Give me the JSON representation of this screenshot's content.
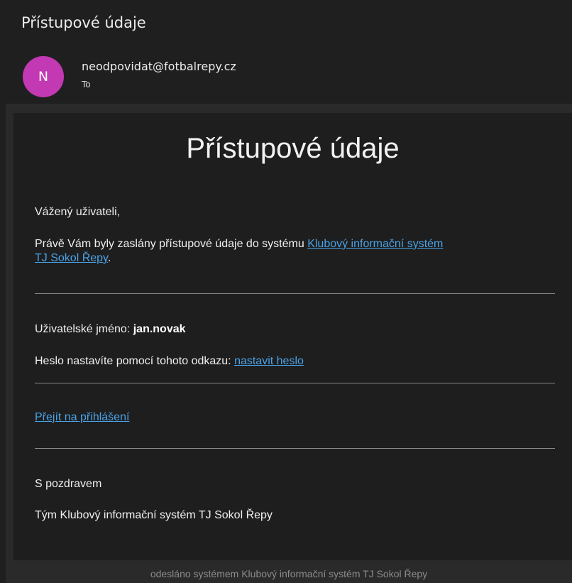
{
  "message": {
    "subject": "Přístupové údaje",
    "sender": {
      "avatar_initial": "N",
      "avatar_color": "#c239b3",
      "address": "neodpovidat@fotbalrepy.cz",
      "recipient_label": "To"
    }
  },
  "email": {
    "title": "Přístupové údaje",
    "greeting": "Vážený uživateli,",
    "intro": {
      "text": "Právě Vám byly zaslány přístupové údaje do systému ",
      "link_line1": "Klubový informační systém",
      "link_line2": "TJ Sokol Řepy",
      "suffix": "."
    },
    "username": {
      "label": "Uživatelské jméno: ",
      "value": "jan.novak"
    },
    "password": {
      "label": "Heslo nastavíte pomocí tohoto odkazu: ",
      "link": "nastavit heslo"
    },
    "login_link": "Přejít na přihlášení",
    "closing": "S pozdravem",
    "signature": "Tým Klubový informační systém TJ Sokol Řepy",
    "footer": "odesláno systémem Klubový informační systém TJ Sokol Řepy"
  },
  "colors": {
    "background": "#1f1f1f",
    "card": "#1e1e1e",
    "link": "#4aa3e8",
    "text": "#f0f0f0"
  }
}
